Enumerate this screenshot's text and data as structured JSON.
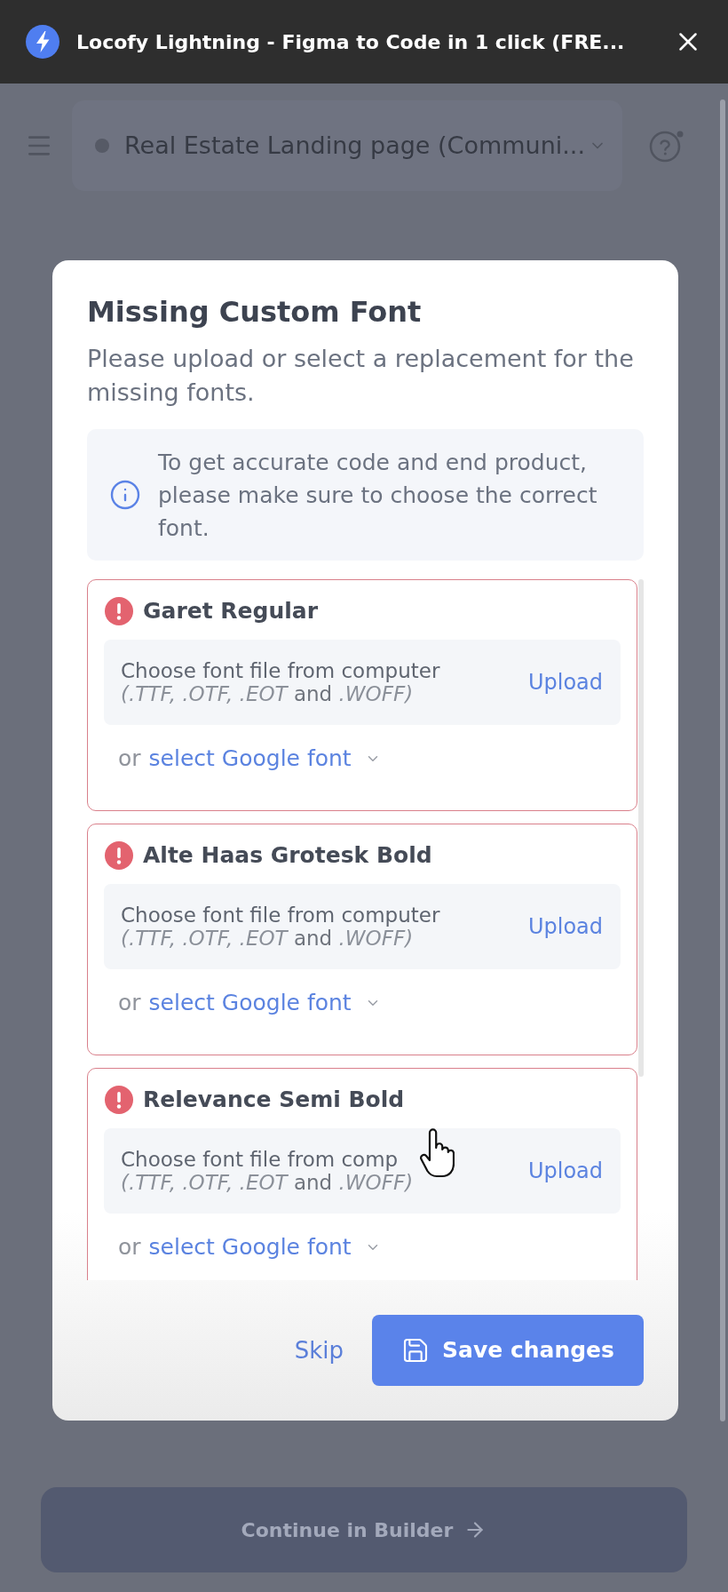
{
  "window": {
    "title": "Locofy Lightning - Figma to Code in 1 click (FRE..."
  },
  "page": {
    "project": "Real Estate Landing page (Communi...",
    "continue_button": "Continue in Builder"
  },
  "dialog": {
    "title": "Missing Custom Font",
    "subtitle": "Please upload or select a replacement for the missing fonts.",
    "notice": "To get accurate code and end product, please make sure to choose the correct font.",
    "fonts": [
      {
        "name": "Garet Regular",
        "upload_prompt": "Choose font file from computer",
        "formats": "*(.TTF, .OTF, .EOT* and *.WOFF)*",
        "upload_button": "Upload",
        "alternative_prefix": "or",
        "alternative_link": "select Google font"
      },
      {
        "name": "Alte Haas Grotesk Bold",
        "upload_prompt": "Choose font file from computer",
        "formats": "*(.TTF, .OTF, .EOT* and *.WOFF)*",
        "upload_button": "Upload",
        "alternative_prefix": "or",
        "alternative_link": "select Google font"
      },
      {
        "name": "Relevance Semi Bold",
        "upload_prompt": "Choose font file from comp",
        "formats": "*(.TTF, .OTF, .EOT* and *.WOFF)*",
        "upload_button": "Upload",
        "alternative_prefix": "or",
        "alternative_link": "select Google font"
      }
    ],
    "skip_button": "Skip",
    "save_button": "Save changes"
  }
}
